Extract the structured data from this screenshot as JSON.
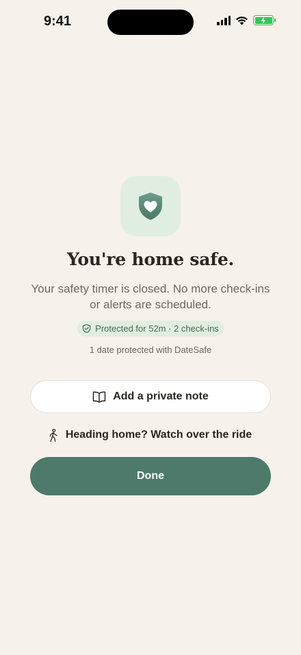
{
  "status_bar": {
    "time": "9:41",
    "icons": [
      "cellular-signal-icon",
      "wifi-icon",
      "battery-charging-icon"
    ]
  },
  "hero": {
    "icon": "shield-heart-icon",
    "title": "You're home safe.",
    "subtitle": "Your safety timer is closed. No more check-ins or alerts are scheduled."
  },
  "protected_badge": {
    "icon": "shield-check-icon",
    "text": "Protected for 52m · 2 check-ins"
  },
  "date_count_text": "1 date protected with DateSafe",
  "actions": {
    "note_button": {
      "icon": "book-open-icon",
      "label": "Add a private note"
    },
    "ride_link": {
      "icon": "walking-person-icon",
      "label": "Heading home? Watch over the ride"
    },
    "done_button": {
      "label": "Done"
    }
  },
  "colors": {
    "background": "#f6f1ea",
    "accent": "#4d7a6a",
    "badge_bg": "#e1ede0",
    "badge_text": "#3f6d4f",
    "icon_tile_bg": "#dfeee0",
    "battery": "#34c759"
  }
}
